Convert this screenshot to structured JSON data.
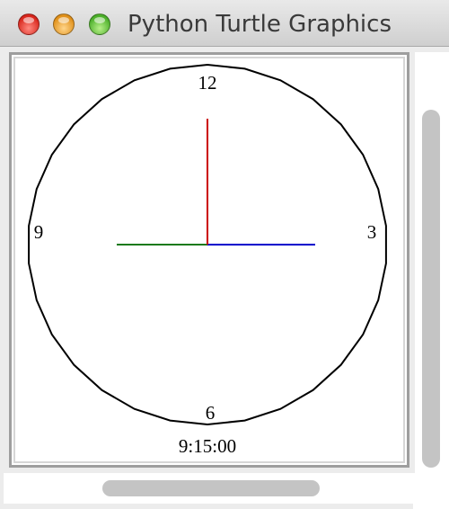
{
  "window": {
    "title": "Python Turtle Graphics",
    "controls": {
      "close_icon": "close-icon",
      "minimize_icon": "minimize-icon",
      "zoom_icon": "zoom-icon"
    }
  },
  "clock": {
    "numerals": {
      "twelve": "12",
      "three": "3",
      "six": "6",
      "nine": "9"
    },
    "digital_time": "9:15:00",
    "hands": {
      "hour": {
        "color": "#1a7a1a",
        "position": 9
      },
      "minute": {
        "color": "#0000cc",
        "position": 15
      },
      "second": {
        "color": "#cc0000",
        "position": 0
      }
    },
    "face_color": "#000000"
  },
  "scrollbars": {
    "vertical": {
      "visible": true
    },
    "horizontal": {
      "visible": true
    }
  }
}
